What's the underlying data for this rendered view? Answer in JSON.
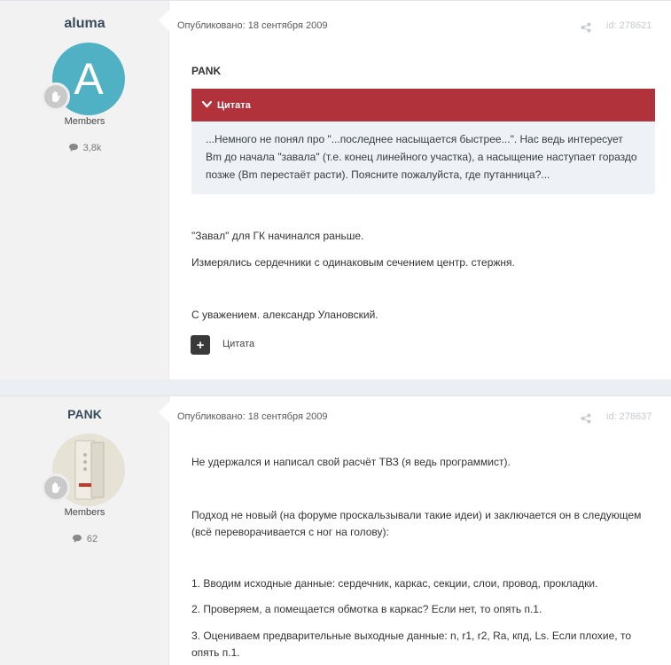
{
  "posts": [
    {
      "author": "aluma",
      "avatar_letter": "A",
      "group": "Members",
      "post_count": "3,8k",
      "published": "Опубликовано: 18 сентября 2009",
      "id": "id: 278621",
      "quoted_author": "PANK",
      "quote_label": "Цитата",
      "quote_text": "...Немного не понял про \"...последнее насыщается быстрее...\". Нас ведь интересует Bm до начала \"завала\" (т.е. конец линейного участка), а насыщение наступает гораздо позже (Bm перестаёт расти). Поясните пожалуйста, где путанница?...",
      "paragraphs": [
        "\"Завал\" для ГК начинался раньше.",
        "Измерялись сердечники с одинаковым сечением центр. стержня.",
        "С уважением. александр Улановский."
      ],
      "reply_label": "Цитата"
    },
    {
      "author": "PANK",
      "group": "Members",
      "post_count": "62",
      "published": "Опубликовано: 18 сентября 2009",
      "id": "id: 278637",
      "paragraphs": [
        "Не удержался и написал свой расчёт ТВЗ (я ведь программист).",
        "Подход не новый (на форуме проскальзывали такие идеи) и заключается он в следующем (всё переворачивается с ног на голову):",
        "1. Вводим исходные данные: сердечник, каркас, секции, слои, провод, прокладки.",
        "2. Проверяем, а помещается обмотка в каркас? Если нет, то опять п.1.",
        "3. Оцениваем предварительные выходные данные: n, r1, r2, Ra, кпд, Ls. Если плохие, то опять п.1."
      ]
    }
  ],
  "colors": {
    "quote_header": "#b2323c",
    "avatar_bg": "#4fb1c3",
    "author_name": "#384a5c"
  },
  "icons": {
    "rank": "hand-badge-icon",
    "comment": "comment-icon",
    "share": "share-icon",
    "quote_toggle": "chevron-down-icon",
    "reply": "plus-icon"
  }
}
